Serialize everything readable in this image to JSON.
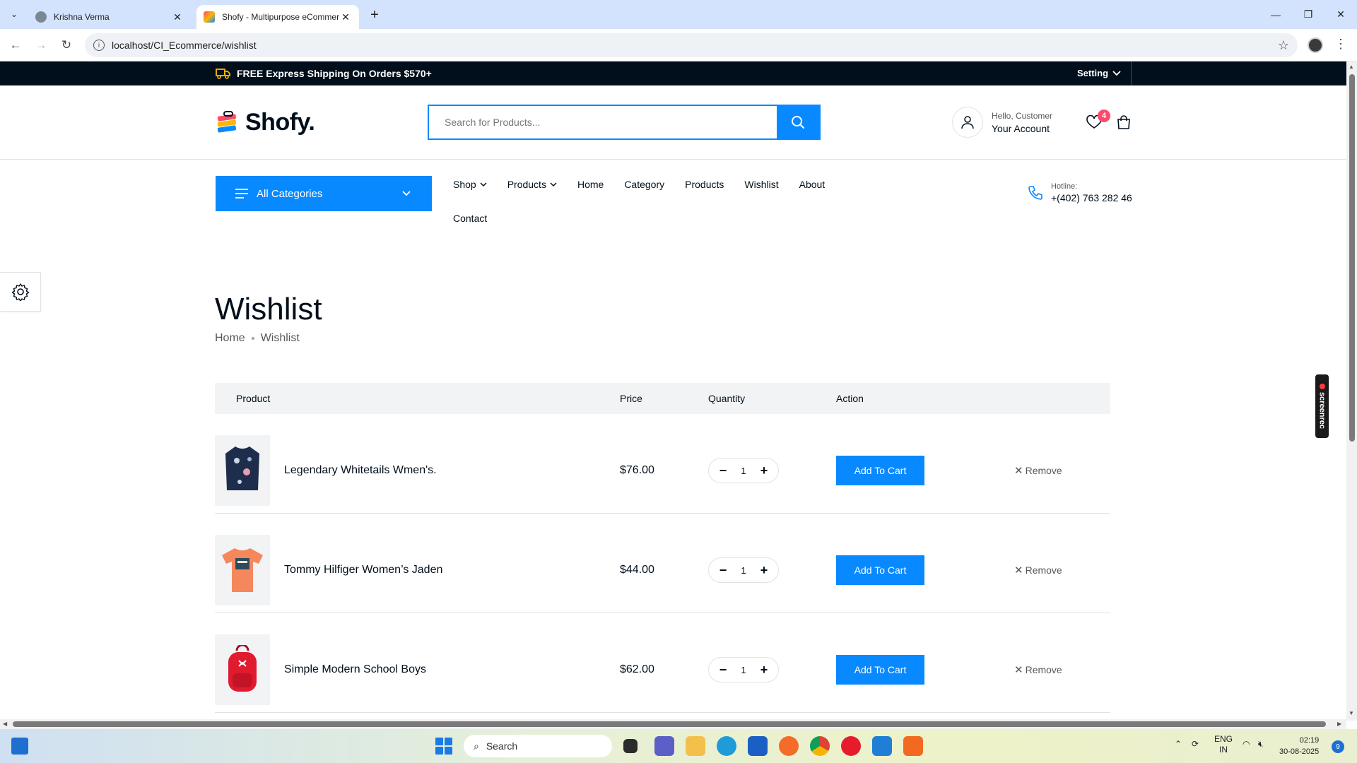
{
  "browser": {
    "tabs": [
      {
        "title": "Krishna Verma"
      },
      {
        "title": "Shofy - Multipurpose eCommer"
      }
    ],
    "url": "localhost/CI_Ecommerce/wishlist"
  },
  "topbar": {
    "shipping_text": "FREE Express Shipping On Orders $570+",
    "setting_label": "Setting"
  },
  "header": {
    "logo_text": "Shofy.",
    "search_placeholder": "Search for Products...",
    "account_greeting": "Hello, Customer",
    "account_label": "Your Account",
    "wishlist_count": "4"
  },
  "nav": {
    "categories_label": "All Categories",
    "items": [
      "Shop",
      "Products",
      "Home",
      "Category",
      "Products",
      "Wishlist",
      "About",
      "Contact"
    ],
    "hotline_label": "Hotline:",
    "hotline_number": "+(402) 763 282 46"
  },
  "page": {
    "title": "Wishlist",
    "breadcrumb": [
      "Home",
      "Wishlist"
    ]
  },
  "table": {
    "headers": [
      "Product",
      "Price",
      "Quantity",
      "Action"
    ],
    "add_to_cart_label": "Add To Cart",
    "remove_label": "Remove",
    "rows": [
      {
        "name": "Legendary Whitetails Wmen's.",
        "price": "$76.00",
        "qty": "1"
      },
      {
        "name": "Tommy Hilfiger Women’s Jaden",
        "price": "$44.00",
        "qty": "1"
      },
      {
        "name": "Simple Modern School Boys",
        "price": "$62.00",
        "qty": "1"
      }
    ]
  },
  "overlay": {
    "screenrec_label": "screenrec"
  },
  "taskbar": {
    "search_label": "Search",
    "lang_top": "ENG",
    "lang_bottom": "IN",
    "time": "02:19",
    "date": "30-08-2025",
    "notification_count": "9"
  },
  "colors": {
    "accent": "#0989ff",
    "topbar_bg": "#010f1c",
    "badge": "#fd4b6b"
  }
}
